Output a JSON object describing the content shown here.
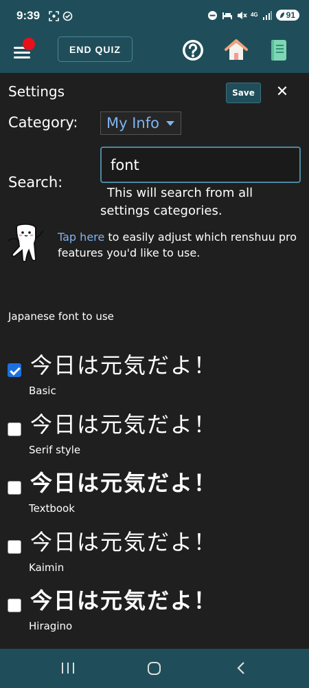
{
  "status_bar": {
    "time": "9:39",
    "network": "4G",
    "battery": "91"
  },
  "header": {
    "end_quiz_label": "END QUIZ",
    "icons": [
      "menu-icon",
      "help-icon",
      "home-icon",
      "notebook-icon"
    ]
  },
  "settings": {
    "title": "Settings",
    "save_label": "Save",
    "close_label": "✕",
    "category_label": "Category:",
    "category_value": "My Info",
    "search_label": "Search:",
    "search_value": "font",
    "search_hint": "This will search from all settings categories.",
    "tap_link": "Tap here",
    "tap_rest": " to easily adjust which renshuu pro features you'd like to use."
  },
  "font_section": {
    "heading": "Japanese font to use",
    "options": [
      {
        "sample": "今日は元気だよ！",
        "name": "Basic",
        "checked": true
      },
      {
        "sample": "今日は元気だよ！",
        "name": "Serif style",
        "checked": false
      },
      {
        "sample": "今日は元気だよ！",
        "name": "Textbook",
        "checked": false
      },
      {
        "sample": "今日は元気だよ！",
        "name": "Kaimin",
        "checked": false
      },
      {
        "sample": "今日は元気だよ！",
        "name": "Hiragino",
        "checked": false
      }
    ]
  },
  "colors": {
    "header_bg": "#1f4e5a",
    "body_bg": "#1f1f1f",
    "link": "#7fb4f0",
    "checkbox_checked": "#1e6fe0",
    "notification_dot": "#e8101a"
  }
}
